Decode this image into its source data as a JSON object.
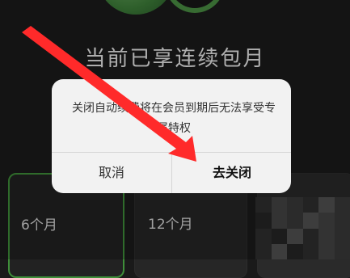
{
  "header": {
    "title": "当前已享连续包月"
  },
  "plans": [
    {
      "label": "6个月"
    },
    {
      "label": "12个月"
    }
  ],
  "dialog": {
    "message": "关闭自动续费将在会员到期后无法享受专属特权",
    "cancel_label": "取消",
    "confirm_label": "去关闭"
  },
  "colors": {
    "background": "#1b1b1b",
    "accent_green": "#3f8f3a",
    "arrow_red": "#ff2a2a",
    "dialog_bg": "#f2f2f2"
  },
  "icons": {
    "logo": "green-leaf-logo",
    "annotation": "red-arrow"
  }
}
